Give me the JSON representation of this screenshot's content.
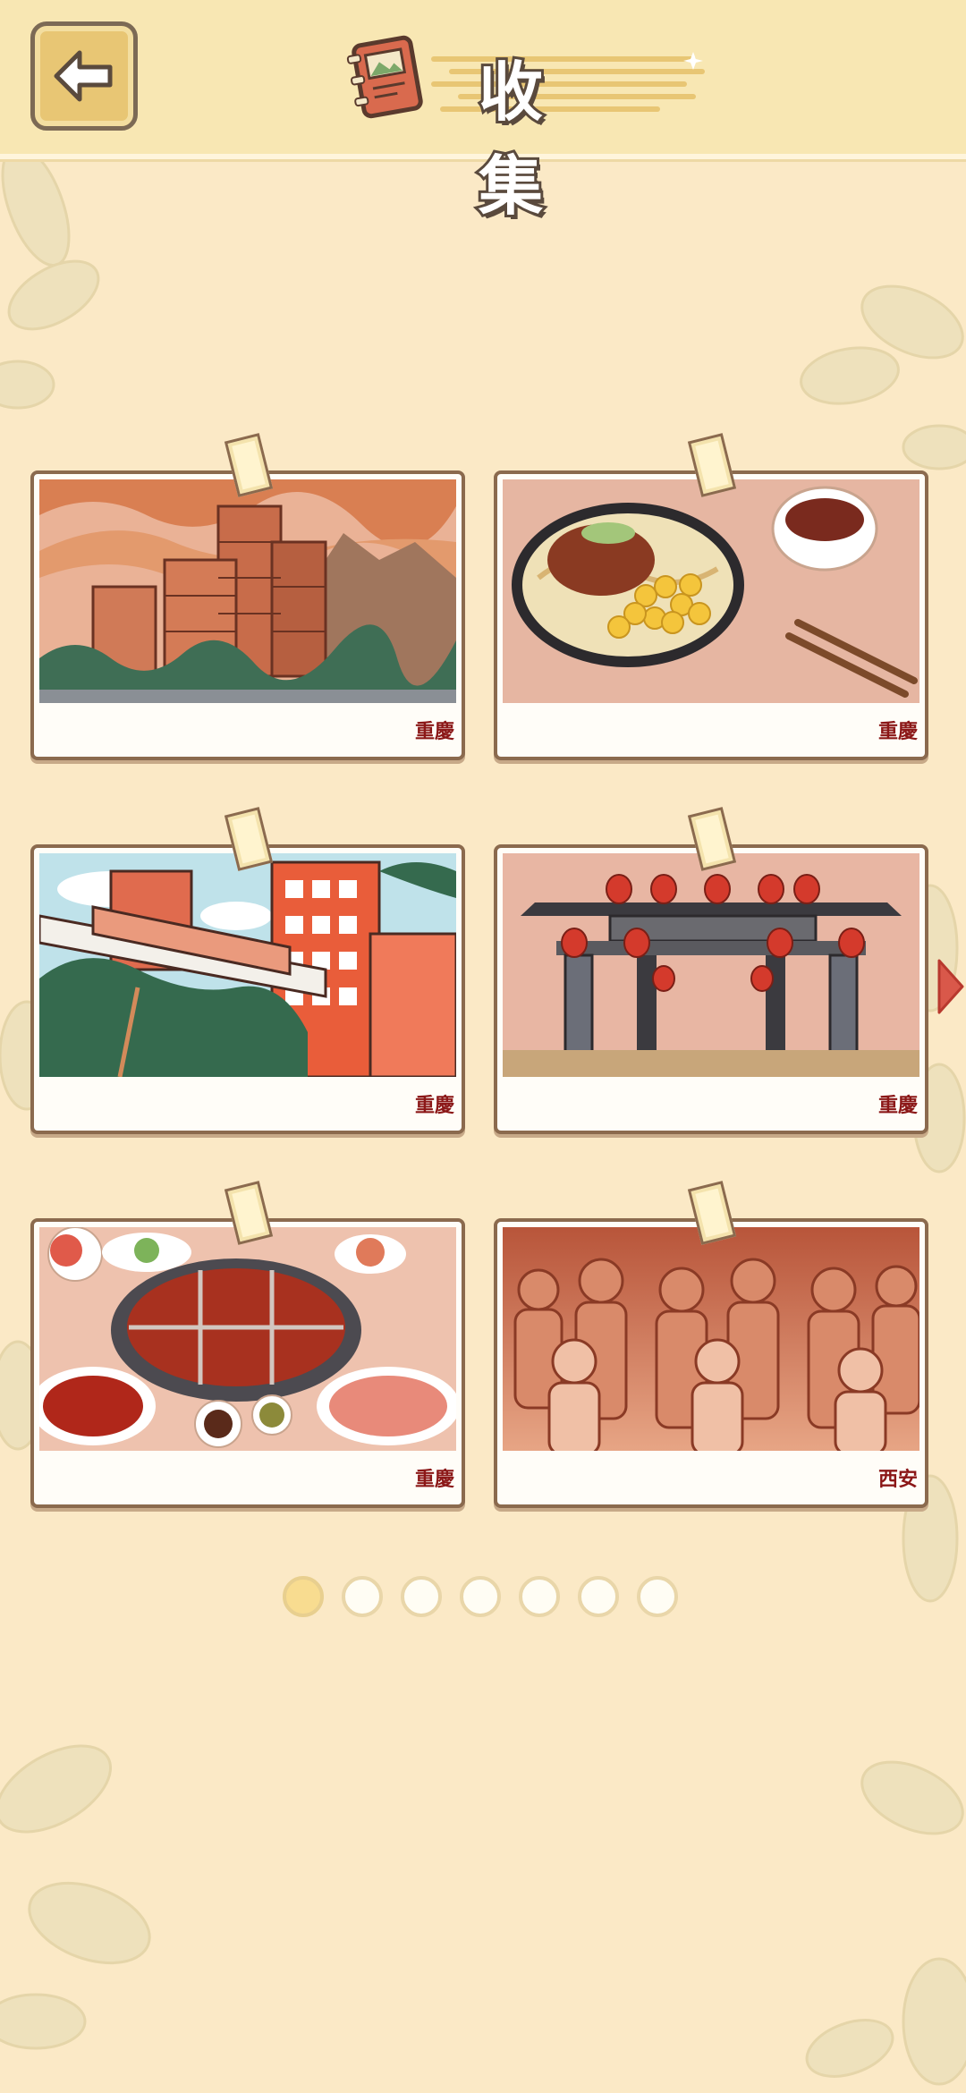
{
  "header": {
    "title": "收 集",
    "back_icon": "back-arrow-icon",
    "book_icon": "album-book-icon"
  },
  "cards": [
    {
      "label": "重慶",
      "image": "hongyadong-stilt-buildings"
    },
    {
      "label": "重慶",
      "image": "chongqing-noodles-bowl"
    },
    {
      "label": "重慶",
      "image": "monorail-through-building"
    },
    {
      "label": "重慶",
      "image": "ciqikou-gate-lanterns"
    },
    {
      "label": "重慶",
      "image": "hotpot-feast"
    },
    {
      "label": "西安",
      "image": "terracotta-warriors"
    }
  ],
  "pagination": {
    "total_pages": 7,
    "current_page": 1
  },
  "colors": {
    "background": "#fbe9c6",
    "header": "#f8e7b3",
    "frame": "#8b6a4e",
    "label": "#8b1717",
    "accent": "#e8c674",
    "next_arrow": "#d9584a"
  }
}
